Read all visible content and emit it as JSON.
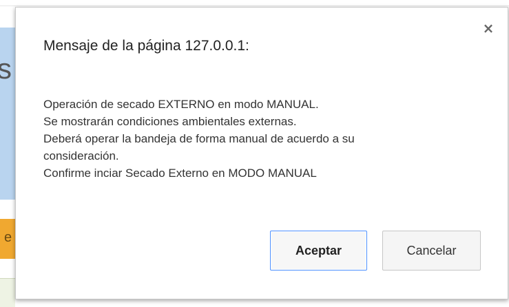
{
  "dialog": {
    "title": "Mensaje de la página 127.0.0.1:",
    "close_glyph": "×",
    "message_lines": [
      "Operación de secado EXTERNO en modo MANUAL.",
      "Se mostrarán condiciones ambientales externas.",
      "Deberá operar la bandeja de forma manual de acuerdo a su",
      "consideración.",
      "Confirme inciar Secado Externo en MODO MANUAL"
    ],
    "accept_label": "Aceptar",
    "cancel_label": "Cancelar"
  },
  "background": {
    "fragment_letter_top": "s",
    "fragment_letter_bottom": "e"
  },
  "colors": {
    "accept_border": "#4d90fe",
    "bg_blue": "#b9d4ef",
    "bg_orange": "#f0a830"
  },
  "icons": {
    "close": "close-icon"
  }
}
